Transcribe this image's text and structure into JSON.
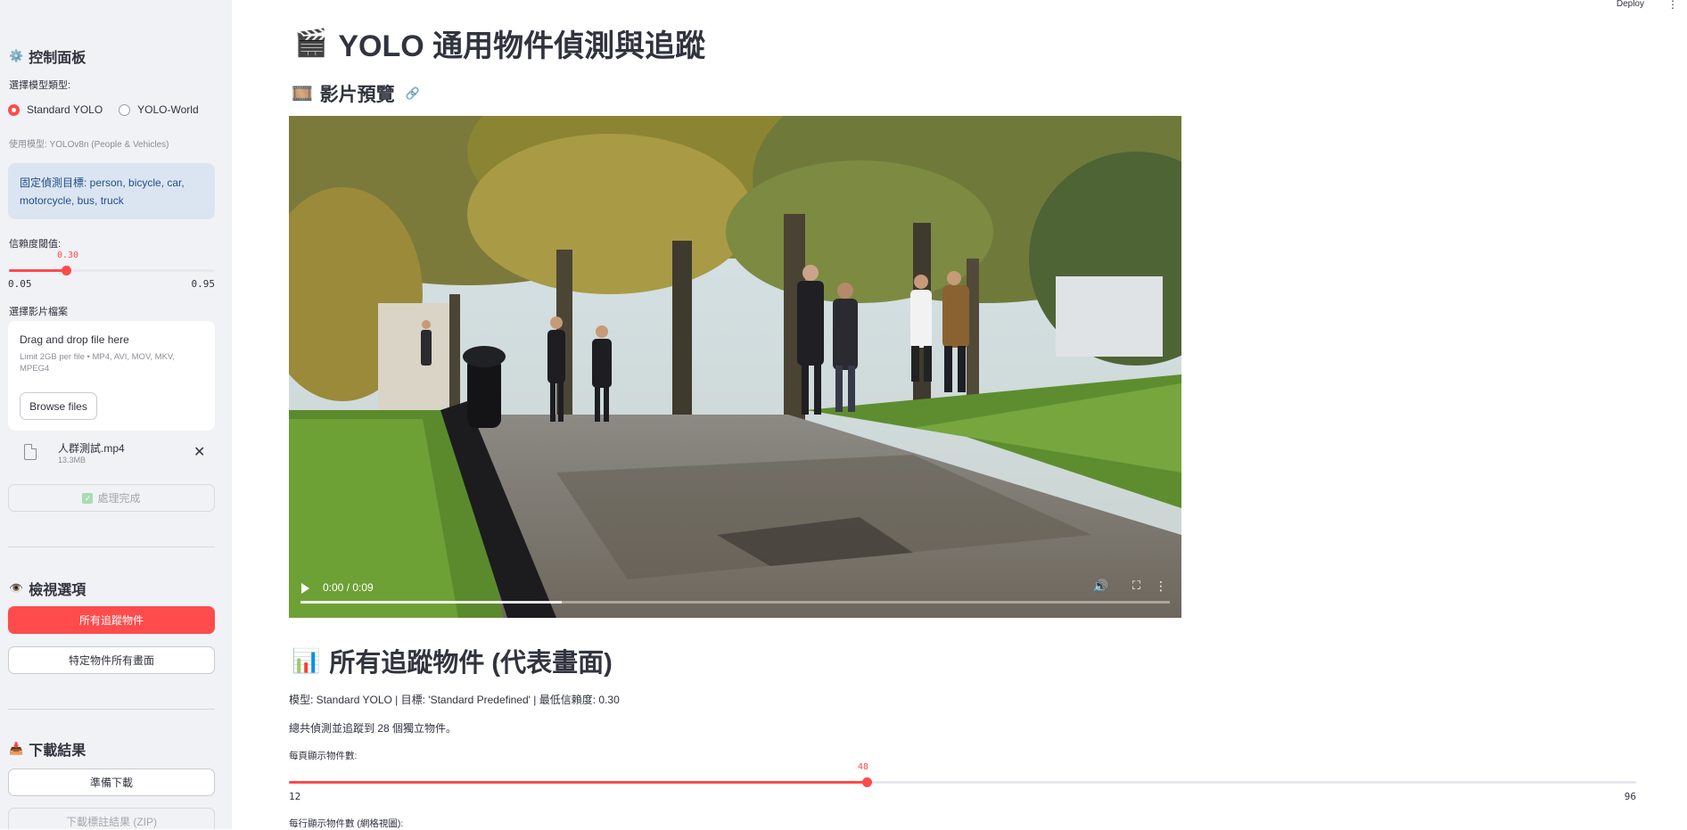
{
  "sidebar": {
    "control_title": "控制面板",
    "model_type_label": "選擇模型類型:",
    "model_options": [
      "Standard YOLO",
      "YOLO-World"
    ],
    "selected_model_index": 0,
    "model_caption": "使用模型: YOLOv8n (People & Vehicles)",
    "fixed_targets": "固定偵測目標: person, bicycle, car, motorcycle, bus, truck",
    "confidence": {
      "label": "信賴度閾值:",
      "value": "0.30",
      "min": "0.05",
      "max": "0.95",
      "fraction": 0.278
    },
    "file_select_label": "選擇影片檔案",
    "uploader": {
      "title": "Drag and drop file here",
      "limit": "Limit 2GB per file • MP4, AVI, MOV, MKV, MPEG4",
      "browse": "Browse files"
    },
    "file": {
      "name": "人群測試.mp4",
      "size": "13.3MB"
    },
    "process_button": "處理完成",
    "view_title": "檢視選項",
    "view_all_button": "所有追蹤物件",
    "view_specific_button": "特定物件所有畫面",
    "download_title": "下載結果",
    "prepare_download_button": "準備下載",
    "download_zip_button": "下載標註結果 (ZIP)"
  },
  "header": {
    "deploy": "Deploy"
  },
  "main": {
    "title": "YOLO 通用物件偵測與追蹤",
    "preview_title": "影片預覽",
    "video": {
      "time": "0:00 / 0:09",
      "buffered_fraction": 0.3
    },
    "objects_title": "所有追蹤物件 (代表畫面)",
    "summary_line": "模型: Standard YOLO | 目標: 'Standard Predefined' | 最低信賴度: 0.30",
    "count_line": "總共偵測並追蹤到 28 個獨立物件。",
    "per_page": {
      "label": "每頁顯示物件數:",
      "value": "48",
      "min": "12",
      "max": "96",
      "fraction": 0.4286
    },
    "per_row_label": "每行顯示物件數 (網格視圖):"
  },
  "colors": {
    "accent": "#ff4b4b",
    "sidebar_bg": "#f0f2f6",
    "info_bg": "#dbe5f2",
    "info_text": "#1f4f8a"
  }
}
